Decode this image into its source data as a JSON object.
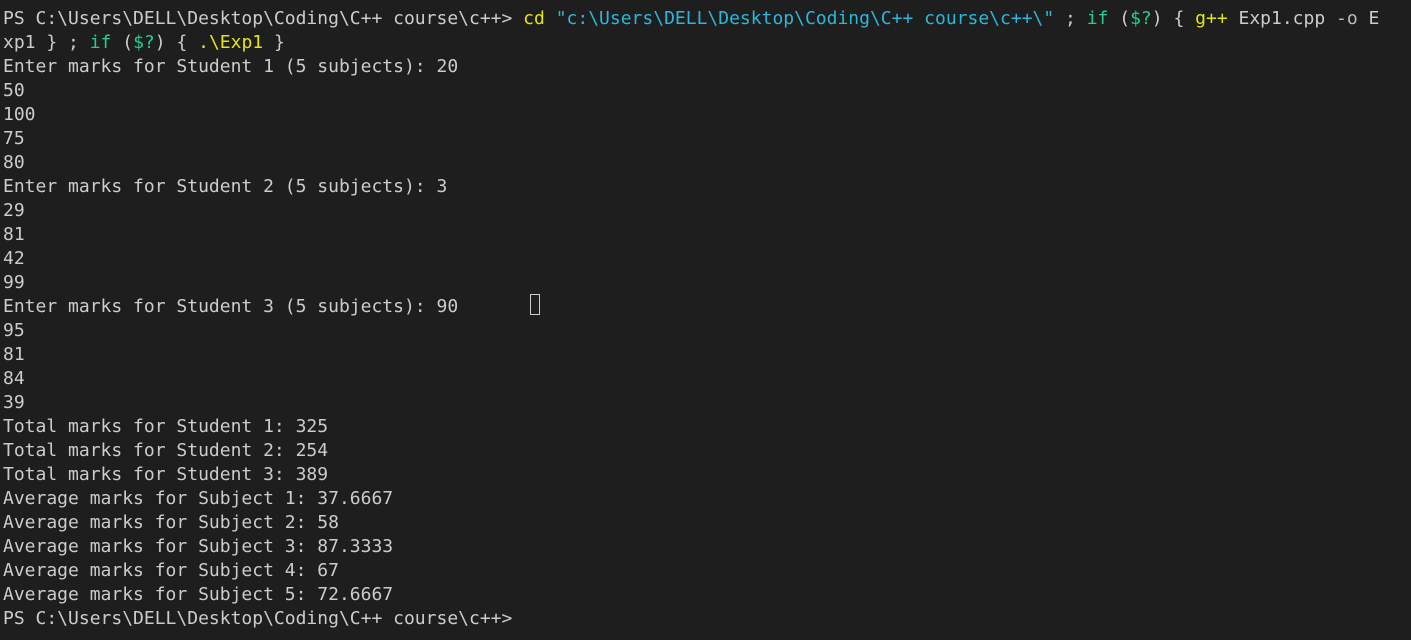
{
  "terminal": {
    "cmd": {
      "prompt": "PS C:\\Users\\DELL\\Desktop\\Coding\\C++ course\\c++> ",
      "cd": "cd",
      "path": "\"c:\\Users\\DELL\\Desktop\\Coding\\C++ course\\c++\\\"",
      "semi1": " ; ",
      "if1": "if",
      "sp1": " (",
      "status1": "$?",
      "close1": ") { ",
      "gpp": "g++",
      "args": " Exp1.cpp ",
      "flag": "-o",
      "out_part1": " E",
      "out_part2": "xp1",
      "brace_semi": " } ; ",
      "if2": "if",
      "sp2": " (",
      "status2": "$?",
      "close2": ") { ",
      "run": ".\\Exp1",
      "end": " }"
    },
    "lines": [
      "Enter marks for Student 1 (5 subjects): 20",
      "50",
      "100",
      "75",
      "80",
      "Enter marks for Student 2 (5 subjects): 3",
      "29",
      "81",
      "42",
      "99",
      "Enter marks for Student 3 (5 subjects): 90",
      "95",
      "81",
      "84",
      "39",
      "Total marks for Student 1: 325",
      "Total marks for Student 2: 254",
      "Total marks for Student 3: 389",
      "Average marks for Subject 1: 37.6667",
      "Average marks for Subject 2: 58",
      "Average marks for Subject 3: 87.3333",
      "Average marks for Subject 4: 67",
      "Average marks for Subject 5: 72.6667"
    ],
    "final_prompt": "PS C:\\Users\\DELL\\Desktop\\Coding\\C++ course\\c++> ",
    "colors": {
      "background": "#1e1e1e",
      "text": "#cccccc",
      "command": "#e5e510",
      "string": "#29b8db",
      "keyword": "#23d18b"
    }
  }
}
